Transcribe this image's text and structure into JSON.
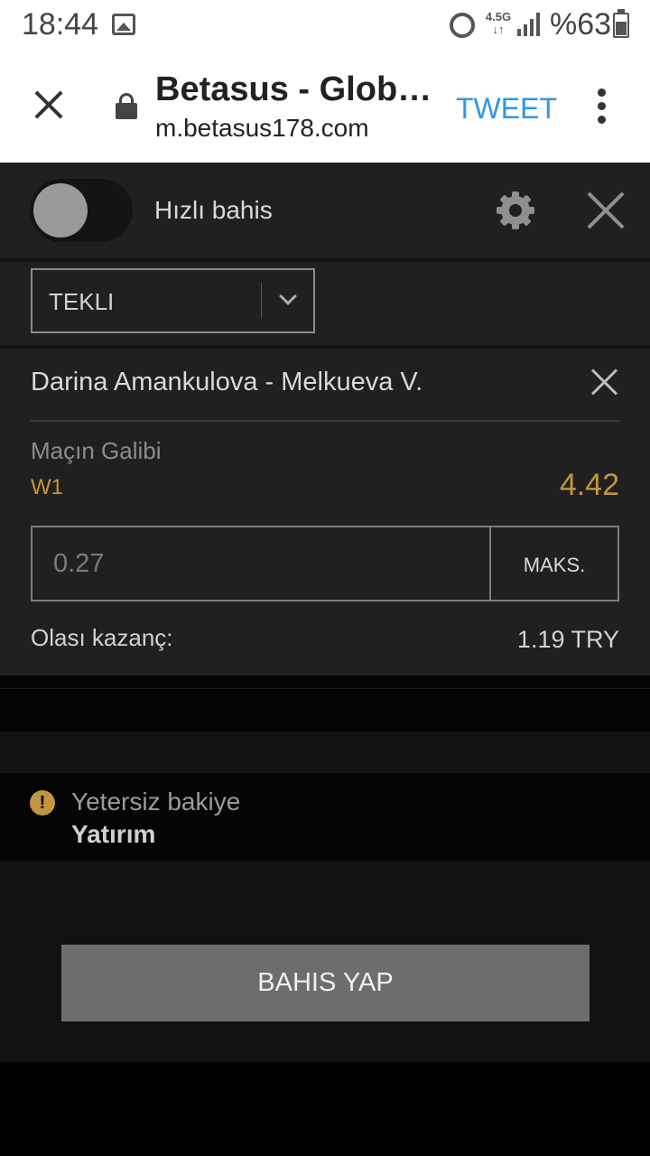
{
  "status_bar": {
    "time": "18:44",
    "network": "4.5G",
    "battery": "%63",
    "icons": [
      "image-icon",
      "alarm-icon",
      "signal-icon",
      "battery-icon"
    ]
  },
  "browser": {
    "title": "Betasus - Glob…",
    "url": "m.betasus178.com",
    "action": "TWEET",
    "action_color": "#2e96e6"
  },
  "header": {
    "quick_bet_label": "Hızlı bahis",
    "quick_bet_enabled": false
  },
  "bet_type": {
    "selected": "TEKLI"
  },
  "bet": {
    "match": "Darina Amankulova - Melkueva V.",
    "market": "Maçın Galibi",
    "selection": "W1",
    "odds": "4.42",
    "stake_placeholder": "0.27",
    "max_label": "MAKS.",
    "potential_label": "Olası kazanç:",
    "potential_value": "1.19 TRY",
    "accent_color": "#c2953e"
  },
  "warning": {
    "title": "Yetersiz bakiye",
    "link": "Yatırım"
  },
  "footer": {
    "place_bet_label": "BAHIS YAP"
  }
}
